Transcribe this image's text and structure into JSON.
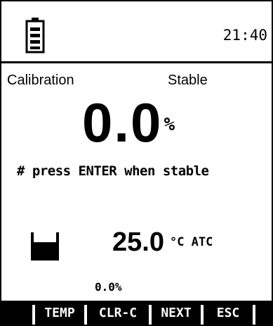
{
  "status_bar": {
    "battery_icon": "battery-icon",
    "time": "21:40"
  },
  "measurement": {
    "mode": "Calibration",
    "state": "Stable",
    "value": "0.0",
    "unit": "%",
    "instruction": "# press ENTER when stable"
  },
  "temperature": {
    "beaker_icon": "beaker-icon",
    "value": "25.0",
    "unit": "°C ATC"
  },
  "secondary_reading": "0.0%",
  "softkeys": [
    {
      "label": "TEMP"
    },
    {
      "label": "CLR-C"
    },
    {
      "label": "NEXT"
    },
    {
      "label": "ESC"
    }
  ],
  "colors": {
    "background": "#ffffff",
    "foreground": "#000000"
  }
}
